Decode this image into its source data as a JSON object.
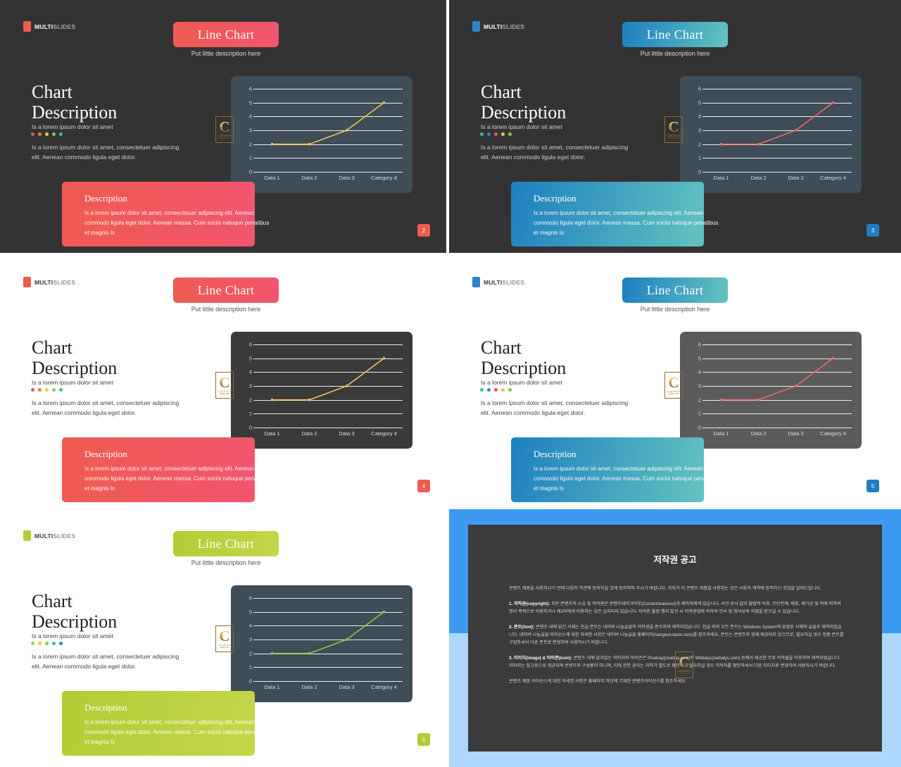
{
  "brand": {
    "logo_bold": "MULTI",
    "logo_light": "SLIDES",
    "contents_mark_letter": "C",
    "contents_mark_text": "CONTENTS",
    "contents_mark_sub": "TEMPLATE"
  },
  "common": {
    "title": "Line Chart",
    "subtitle": "Put little description here",
    "desc_head_line1": "Chart",
    "desc_head_line2": "Description",
    "desc_sub": "Is a lorem ipsum dolor sit amet",
    "desc_body": "Is a lorem ipsum dolor sit amet, consectetuer adipiscing elit. Aenean commodo ligula eget dolor.",
    "card_title": "Description",
    "card_body": "Is a lorem ipsum dolor sit amet, consectetuer adipiscing elit. Aenean commodo ligula eget dolor. Aenean massa. Cum sociis natoque penatibus et magnis Is"
  },
  "chart_data": {
    "type": "line",
    "title": "Line Chart",
    "xlabel": "",
    "ylabel": "",
    "categories": [
      "Data 1",
      "Data 2",
      "Data 3",
      "Category 4"
    ],
    "values": [
      2,
      2,
      3,
      5
    ],
    "ylim": [
      0,
      6
    ],
    "yticks": [
      6,
      5,
      4,
      3,
      2,
      1,
      0
    ],
    "grid": true,
    "legend": "none",
    "markers": true
  },
  "slides": [
    {
      "id": "slide-2",
      "page": "2",
      "theme": "dark",
      "accent": "#ef5b50",
      "accent2": "#f2556f",
      "line_color": "#e8c252",
      "chart_bg": "#3e4d57",
      "logo_color": "#ef5b50",
      "text_color": "#ffffff",
      "sub_color": "#cfcfcf",
      "dots": [
        "#e8516e",
        "#ee7b3f",
        "#e9c84a",
        "#8cc63f",
        "#3fb7a8"
      ]
    },
    {
      "id": "slide-3",
      "page": "3",
      "theme": "dark",
      "accent": "#1e7fc0",
      "accent2": "#63c3c0",
      "line_color": "#ef6767",
      "chart_bg": "#3e4d57",
      "logo_color": "#2f84c6",
      "text_color": "#ffffff",
      "sub_color": "#cfcfcf",
      "dots": [
        "#3fb7a8",
        "#2f84c6",
        "#e8516e",
        "#e9c84a",
        "#8cc63f"
      ]
    },
    {
      "id": "slide-4",
      "page": "4",
      "theme": "light",
      "accent": "#ef5b50",
      "accent2": "#f2556f",
      "line_color": "#e8c252",
      "chart_bg": "#3a3a3b",
      "logo_color": "#ef5b50",
      "text_color": "#222222",
      "sub_color": "#444444",
      "dots": [
        "#e8516e",
        "#ee7b3f",
        "#e9c84a",
        "#8cc63f",
        "#3fb7a8"
      ]
    },
    {
      "id": "slide-5",
      "page": "5",
      "theme": "light",
      "accent": "#1e7fc0",
      "accent2": "#63c3c0",
      "line_color": "#ef6767",
      "chart_bg": "#5b5b5c",
      "logo_color": "#2f84c6",
      "text_color": "#222222",
      "sub_color": "#444444",
      "dots": [
        "#3fb7a8",
        "#2f84c6",
        "#e8516e",
        "#e9c84a",
        "#8cc63f"
      ]
    },
    {
      "id": "slide-6",
      "page": "6",
      "theme": "light",
      "accent": "#b3cc35",
      "accent2": "#c5d64a",
      "line_color": "#8cc63f",
      "chart_bg": "#3e4d57",
      "logo_color": "#b3cc35",
      "text_color": "#222222",
      "sub_color": "#444444",
      "dots": [
        "#b3cc35",
        "#e9c84a",
        "#8cc63f",
        "#3fb7a8",
        "#2f84c6"
      ]
    }
  ],
  "copyright": {
    "title": "저작권 공고",
    "intro": "콘텐츠 제품을 사용하시기 전에 다음의 약관에 동의하실 것에 동의하여 주시기 바랍니다. 귀하가 이 콘텐츠 제품을 사용하는 것은 사용자 계약에 동의하신 것임을 알려드립니다.",
    "s1_label": "1. 저작권(copyright):",
    "s1_text": "모든 콘텐츠의 소유 및 저작권은 콘텐츠테이크아웃(Contentstakeout)과 제작자에게 있습니다. 사전 승낙 없이 불법적 이용, 무단전재, 배포, 재가공 및 이에 의하여 영리 목적으로 이용하거나 제3자에게 이용하는 것은 금지되어 있습니다. 이러한 불법 행위 발견 시 저작권법에 의하여 민사 및 형사상의 처벌을 받으실 수 있습니다.",
    "s2_label": "2. 폰트(font):",
    "s2_text": "콘텐츠 내에 담긴 서체는 한글 폰트는 네이버 나눔글꼴의 저작권을 준수하여 제작되었습니다. 한글 외의 모든 폰트는 Windows System에 포함된 서체와 글꼴로 제작되었습니다. 네이버 나눔글꼴 라이선스에 대한 자세한 사항은 네이버 나눔글꼴 홈페이지(hangeul.naver.com)를 참조하세요. 폰트는 콘텐츠와 함께 제공되지 않으므로, 필요하실 경우 정품 폰트를 구입하셔서 다른 폰트로 변경하여 사용하시기 바랍니다.",
    "s3_label": "3. 이미지(image) & 아이콘(icon):",
    "s3_text": "콘텐츠 내에 담겨있는 이미지와 아이콘은 Pixabay(pixabay.com)와 Webalys(webalys.com) 등에서 제공한 무료 저작물을 이용하여 제작되었습니다. 이미지는 참고용으로 제공되며 콘텐츠의 구성품이 아니며, 이에 관한 권리는 귀하가 별도로 확인하고 필요하실 경우 저작자를 확인하셔서 다른 이미지로 변경하여 사용하시기 바랍니다.",
    "footer": "콘텐츠 제품 라이선스에 대한 자세한 사항은 홈페이지 하단에 기재한 콘텐츠라이선스를 참조하세요."
  }
}
